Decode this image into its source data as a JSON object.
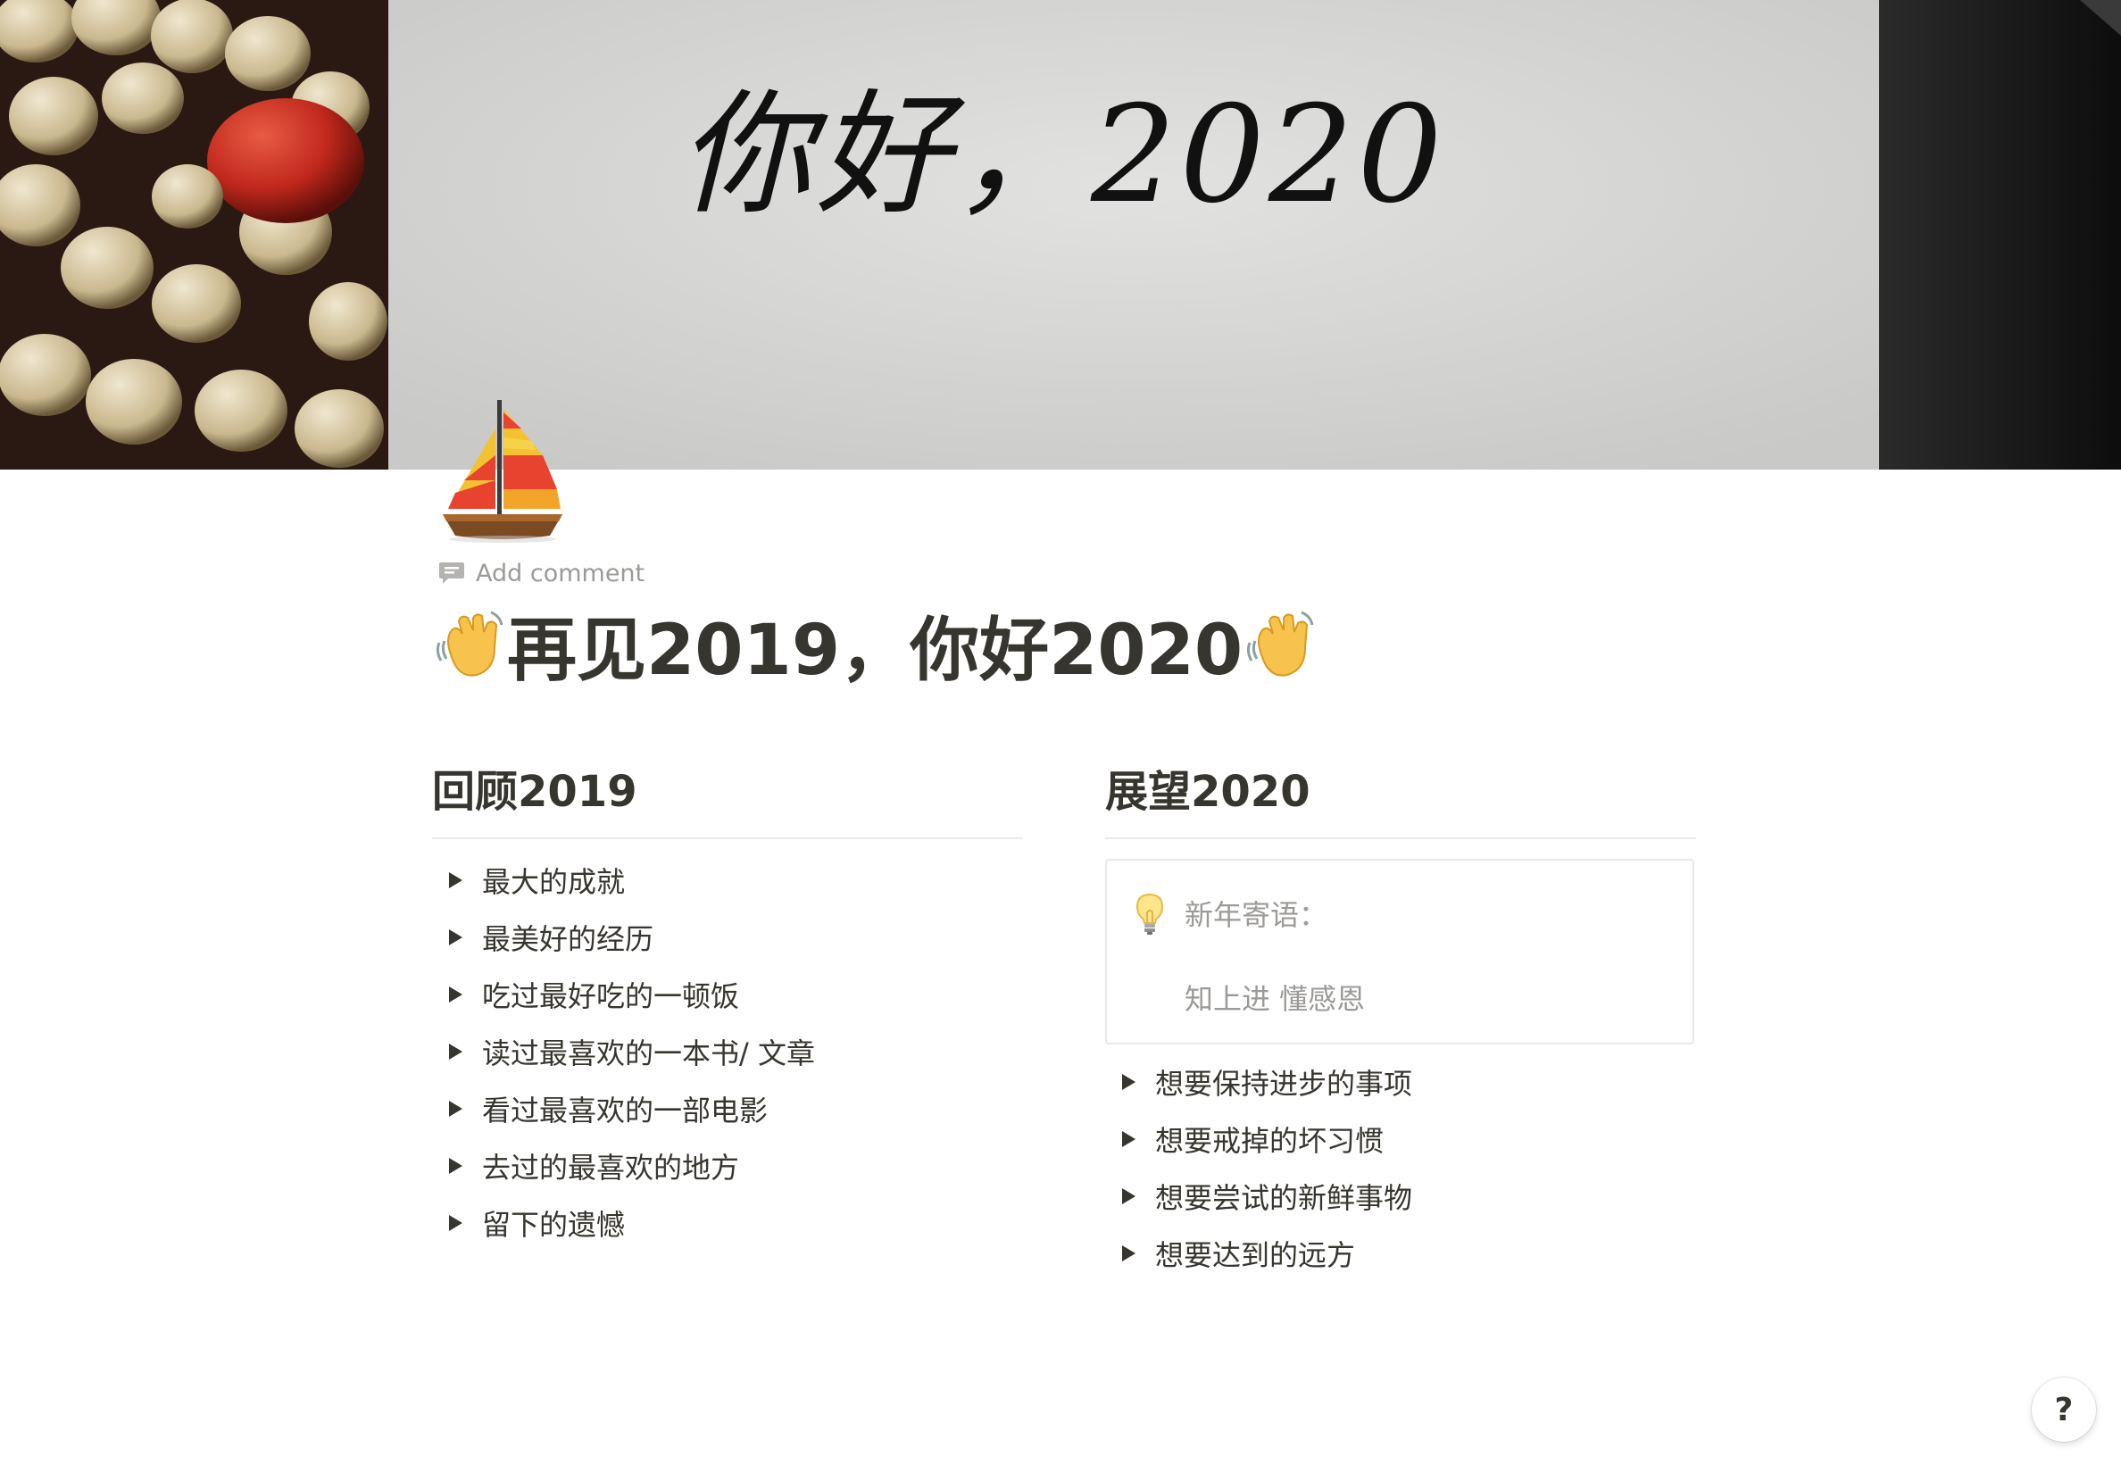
{
  "cover": {
    "handwriting": "你好，2020"
  },
  "page": {
    "icon": "sailboat-icon",
    "add_comment_label": "Add comment",
    "title": "再见2019，你好2020",
    "title_decoration": "waving-hand-icon"
  },
  "left_column": {
    "heading": "回顾2019",
    "items": [
      {
        "label": "最大的成就"
      },
      {
        "label": "最美好的经历"
      },
      {
        "label": "吃过最好吃的一顿饭"
      },
      {
        "label": "读过最喜欢的一本书/ 文章"
      },
      {
        "label": "看过最喜欢的一部电影"
      },
      {
        "label": "去过的最喜欢的地方"
      },
      {
        "label": "留下的遗憾"
      }
    ]
  },
  "right_column": {
    "heading": "展望2020",
    "callout": {
      "icon": "light-bulb-icon",
      "title": "新年寄语：",
      "body": "知上进 懂感恩"
    },
    "items": [
      {
        "label": "想要保持进步的事项"
      },
      {
        "label": "想要戒掉的坏习惯"
      },
      {
        "label": "想要尝试的新鲜事物"
      },
      {
        "label": "想要达到的远方"
      }
    ]
  },
  "help_button_label": "?"
}
